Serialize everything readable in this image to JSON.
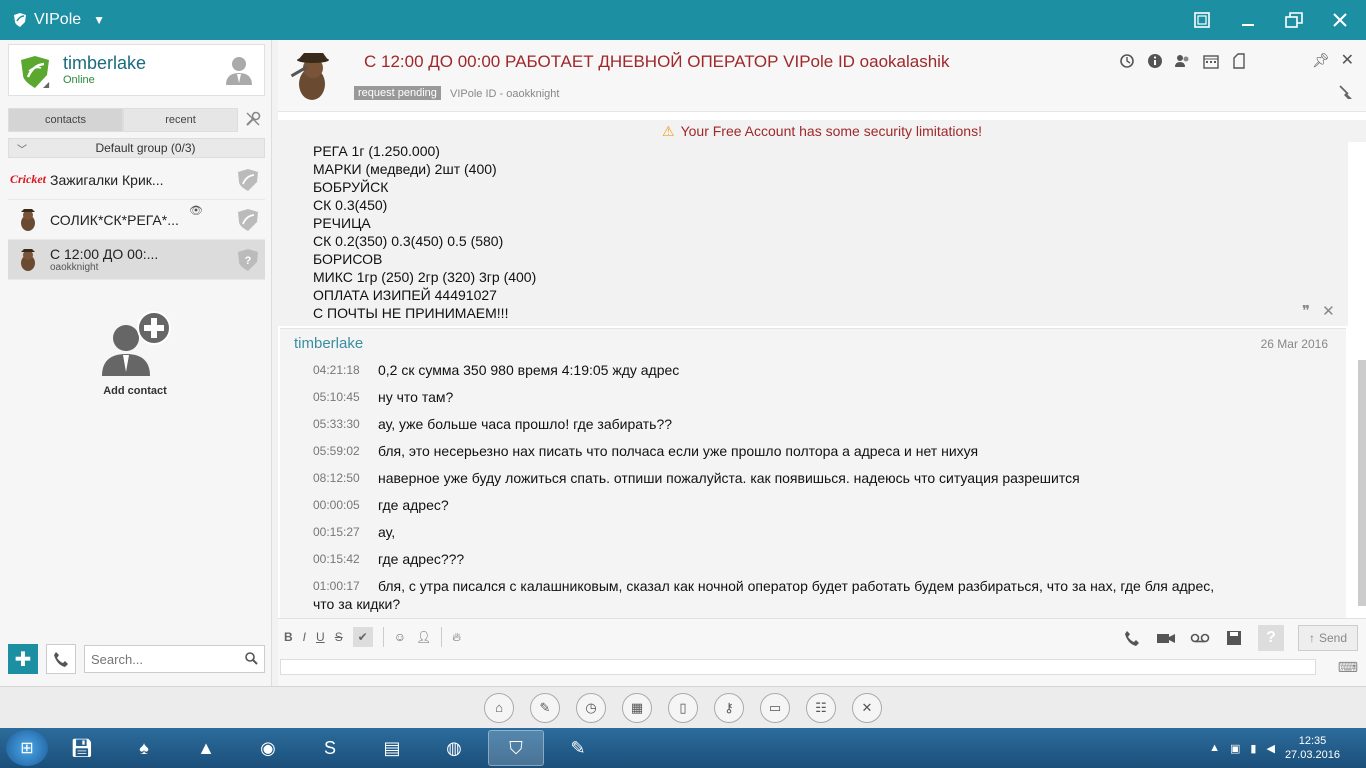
{
  "window": {
    "title": "VIPole"
  },
  "profile": {
    "name": "timberlake",
    "status": "Online"
  },
  "tabs": [
    {
      "label": "contacts"
    },
    {
      "label": "recent"
    }
  ],
  "group": {
    "title": "Default group (0/3)"
  },
  "contacts": [
    {
      "name": "Зажигалки Крик...",
      "logo": "Cricket"
    },
    {
      "name": "СОЛИК*СК*РЕГА*..."
    },
    {
      "name": "С 12:00 ДО 00:...",
      "sub": "oaokknight"
    }
  ],
  "add_contact": {
    "label": "Add contact"
  },
  "search": {
    "placeholder": "Search..."
  },
  "chat": {
    "title": "С 12:00 ДО 00:00 РАБОТАЕТ ДНЕВНОЙ ОПЕРАТОР VIPole ID oaokalashik",
    "badge": "request pending",
    "subtitle": "VIPole ID - oaokknight",
    "warning": "Your Free Account has some security limitations!"
  },
  "quoted_lines": [
    "РЕГА 1г (1.250.000)",
    "МАРКИ (медведи) 2шт (400)",
    "БОБРУЙСК",
    "СК  0.3(450)",
    "РЕЧИЦА",
    "СК 0.2(350) 0.3(450) 0.5 (580)",
    "БОРИСОВ",
    "МИКС 1гр (250) 2гр (320) 3гр (400)",
    "ОПЛАТА ИЗИПЕЙ 44491027",
    "С ПОЧТЫ НЕ ПРИНИМАЕМ!!!"
  ],
  "message_block": {
    "sender": "timberlake",
    "date": "26 Mar 2016",
    "messages": [
      {
        "time": "04:21:18",
        "text": "0,2 ск сумма 350 980 время 4:19:05 жду адрес"
      },
      {
        "time": "05:10:45",
        "text": "ну что там?"
      },
      {
        "time": "05:33:30",
        "text": "ау, уже больше часа прошло! где забирать??"
      },
      {
        "time": "05:59:02",
        "text": "бля, это несерьезно нах писать что полчаса если уже прошло полтора а адреса и нет нихуя"
      },
      {
        "time": "08:12:50",
        "text": "наверное уже буду ложиться спать. отпиши пожалуйста. как появишься. надеюсь что ситуация разрешится"
      },
      {
        "time": "00:00:05",
        "text": "где адрес?"
      },
      {
        "time": "00:15:27",
        "text": "ау,"
      },
      {
        "time": "00:15:42",
        "text": "где адрес???"
      },
      {
        "time": "01:00:17",
        "text": "бля, с утра писался с калашниковым, сказал как ночной оператор будет работать будем разбираться, что за нах, где бля адрес,",
        "cont": "что за кидки?"
      }
    ]
  },
  "composer": {
    "fmt_bold": "B",
    "fmt_italic": "I",
    "fmt_underline": "U",
    "fmt_strike": "S",
    "help": "?",
    "send_label": "Send"
  },
  "taskbar": {
    "time": "12:35",
    "date": "27.03.2016"
  },
  "colors": {
    "brand": "#1d8fa3",
    "title_red": "#a0282a",
    "sender_blue": "#3a8ea0",
    "online_green": "#2a8a3a"
  }
}
